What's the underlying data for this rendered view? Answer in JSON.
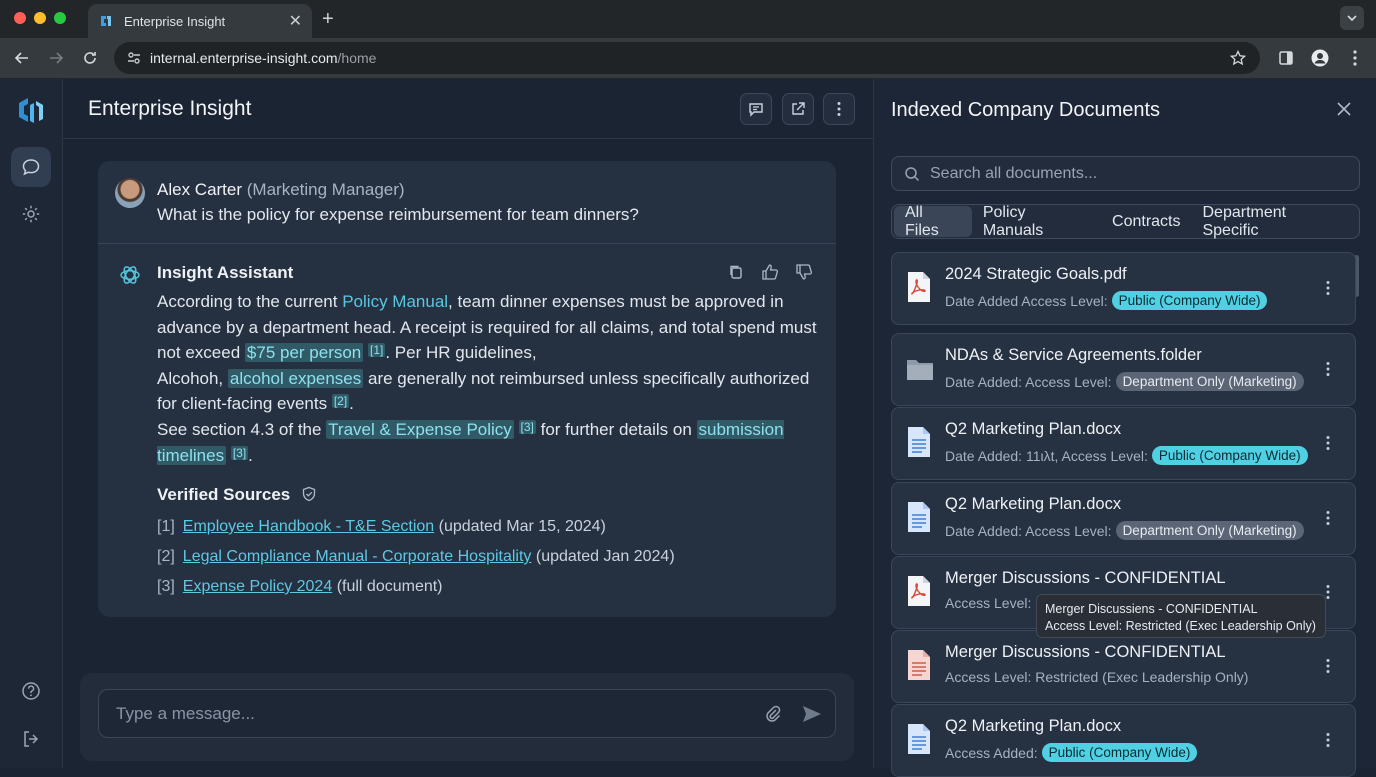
{
  "browser": {
    "tab_title": "Enterprise Insight",
    "url_host": "internal.enterprise-insight.com",
    "url_path": "/home"
  },
  "app": {
    "title": "Enterprise Insight"
  },
  "question": {
    "user_name": "Alex Carter",
    "user_role": "(Marketing Manager)",
    "text": "What is the policy for expense reimbursement for team dinners?"
  },
  "answer": {
    "assistant_name": "Insight Assistant",
    "p1": "According to the current ",
    "link_policy_manual": "Policy Manual",
    "p2": ", team dinner expenses must be approved in advance by a department head. A receipt is required for all claims, and total spend must not exceed ",
    "hl_75": "$75 per person",
    "cite1": "[1]",
    "p3": ". Per HR guidelines,",
    "p4": "Alcohoh, ",
    "hl_alcohol": "alcohol expenses",
    "p5": " are generally not reimbursed unless specifically authorized for client-facing events ",
    "cite2": "[2]",
    "p6": ".",
    "p7": "See section 4.3 of the ",
    "hl_travel": "Travel & Expense Policy",
    "cite3": "[3]",
    "p8": " for further details on ",
    "hl_submission": "submission timelines",
    "cite3b": "[3]",
    "p9": "."
  },
  "sources": {
    "title": "Verified Sources",
    "items": [
      {
        "num": "[1]",
        "link": "Employee Handbook - T&E Section",
        "note": "(updated Mar 15, 2024)"
      },
      {
        "num": "[2]",
        "link": "Legal Compliance Manual - Corporate Hospitality",
        "note": "(updated Jan 2024)"
      },
      {
        "num": "[3]",
        "link": "Expense Policy 2024",
        "note": "(full document)"
      }
    ]
  },
  "composer": {
    "placeholder": "Type a message..."
  },
  "panel": {
    "title": "Indexed Company Documents",
    "search_placeholder": "Search all documents...",
    "filters": [
      "All Files",
      "Policy Manuals",
      "Contracts",
      "Department Specific"
    ],
    "docs": [
      {
        "name": "2024 Strategic Goals.pdf",
        "meta": "Date Added Access Level:",
        "badge": "Public (Company Wide)",
        "badge_type": "pub",
        "icon": "pdf-icon"
      },
      {
        "name": "NDAs & Service Agreements.folder",
        "meta": "Date Added: Access Level:",
        "badge": "Department Only (Marketing)",
        "badge_type": "dept",
        "icon": "folder-icon"
      },
      {
        "name": "Q2 Marketing Plan.docx",
        "meta": "Date Added: 11ιλt, Access Level:",
        "badge": "Public (Company Wide)",
        "badge_type": "pub",
        "icon": "doc-icon"
      },
      {
        "name": "Q2 Marketing Plan.docx",
        "meta": "Date Added: Access Level:",
        "badge": "Department Only (Marketing)",
        "badge_type": "dept",
        "icon": "doc-icon"
      },
      {
        "name": "Merger Discussions - CONFIDENTIAL",
        "meta": "Access Level:",
        "badge": "",
        "badge_type": "",
        "icon": "pdf-icon"
      },
      {
        "name": "Merger Discussions - CONFIDENTIAL",
        "meta": "Access Level: Restricted (Exec Leadership Only)",
        "badge": "",
        "badge_type": "",
        "icon": "pdf-doc-icon"
      },
      {
        "name": "Q2 Marketing Plan.docx",
        "meta": "Access Added:",
        "badge": "Public (Company Wide)",
        "badge_type": "pub",
        "icon": "doc-icon"
      }
    ],
    "tooltip_title": "Merger Discussiens - CONFIDENTIAL",
    "tooltip_body": "Access Level: Restricted (Exec Leadership Only)"
  },
  "colors": {
    "accent": "#59c7e0",
    "badge_public": "#4fd1e3",
    "badge_dept": "#5b6575"
  }
}
